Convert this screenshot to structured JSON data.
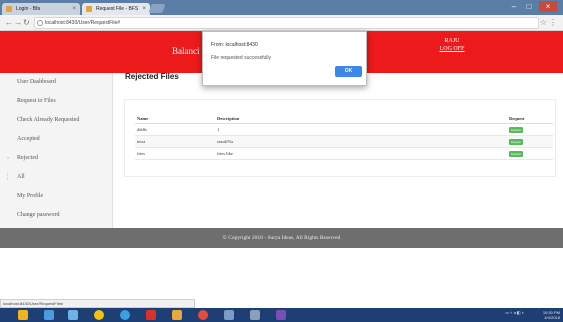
{
  "browser": {
    "tabs": [
      {
        "label": "Login - Bfa"
      },
      {
        "label": "Request File - BFS"
      }
    ],
    "url": "localhost:8430/User/RequestFile#",
    "status_url": "localhost:8430/User/RequestFile#"
  },
  "header": {
    "brand": "Balanci",
    "user_name": "RAJU",
    "logout": "LOG OFF"
  },
  "sidebar": {
    "items": [
      {
        "label": "User Dashboard"
      },
      {
        "label": "Request to Files"
      },
      {
        "label": "Check Already Requested"
      },
      {
        "label": "Accepted"
      },
      {
        "label": "Rejected"
      },
      {
        "label": "All"
      },
      {
        "label": "My Profile"
      },
      {
        "label": "Change password"
      }
    ]
  },
  "main": {
    "title": "Rejected Files",
    "table": {
      "headers": [
        "Name",
        "Description",
        "Request"
      ],
      "rows": [
        {
          "name": "dddfs",
          "description": "1",
          "action": "Request"
        },
        {
          "name": "tesst",
          "description": "ssssdf%s",
          "action": "Request"
        },
        {
          "name": "fries",
          "description": "fries like",
          "action": "Request"
        }
      ]
    }
  },
  "dialog": {
    "title": "From: localhost:8430",
    "message": "File requested successfully",
    "ok_label": "OK"
  },
  "footer": {
    "copyright": "© Copyright 2018 - Surya Ideas, All Rights Reserved"
  },
  "taskbar": {
    "time": "10:30 PM",
    "date": "4/4/2018",
    "icons": [
      "windows-icon",
      "explorer-icon",
      "files-icon",
      "chrome-icon",
      "ie-icon",
      "pdf-icon",
      "folder-icon",
      "opera-icon",
      "mail-icon",
      "media-icon",
      "vs-icon"
    ]
  },
  "colors": {
    "brand_red": "#ec1a1a",
    "ok_blue": "#3e86e8",
    "request_green": "#5cb85c",
    "footer_gray": "#6e6e6e",
    "taskbar_blue": "#1d3f73"
  }
}
